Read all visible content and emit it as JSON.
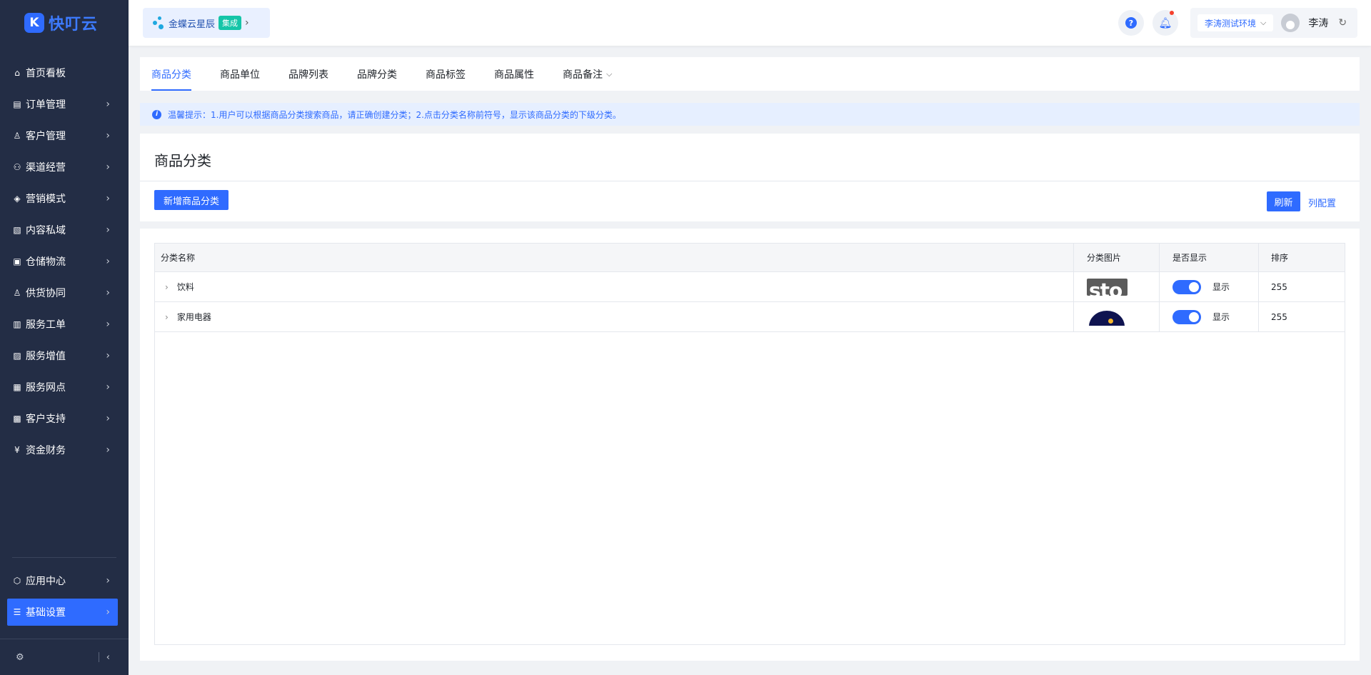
{
  "app": {
    "logo_text": "快叮云",
    "logo_mark": "K"
  },
  "sidebar": {
    "items": [
      {
        "label": "首页看板",
        "icon": "home-icon",
        "glyph": "⌂",
        "arrow": false
      },
      {
        "label": "订单管理",
        "icon": "clipboard-icon",
        "glyph": "▤",
        "arrow": true
      },
      {
        "label": "客户管理",
        "icon": "user-icon",
        "glyph": "♙",
        "arrow": true
      },
      {
        "label": "渠道经营",
        "icon": "channel-icon",
        "glyph": "⚇",
        "arrow": true
      },
      {
        "label": "营销模式",
        "icon": "tag-icon",
        "glyph": "◈",
        "arrow": true
      },
      {
        "label": "内容私域",
        "icon": "image-icon",
        "glyph": "▧",
        "arrow": true
      },
      {
        "label": "仓储物流",
        "icon": "warehouse-icon",
        "glyph": "▣",
        "arrow": true
      },
      {
        "label": "供货协同",
        "icon": "supplier-icon",
        "glyph": "♙",
        "arrow": true
      },
      {
        "label": "服务工单",
        "icon": "ticket-icon",
        "glyph": "▥",
        "arrow": true
      },
      {
        "label": "服务增值",
        "icon": "bag-icon",
        "glyph": "▨",
        "arrow": true
      },
      {
        "label": "服务网点",
        "icon": "store-icon",
        "glyph": "▦",
        "arrow": true
      },
      {
        "label": "客户支持",
        "icon": "support-icon",
        "glyph": "▩",
        "arrow": true
      },
      {
        "label": "资金财务",
        "icon": "yuan-icon",
        "glyph": "¥",
        "arrow": true
      }
    ],
    "bottom_items": [
      {
        "label": "应用中心",
        "icon": "cube-icon",
        "glyph": "⬡"
      },
      {
        "label": "基础设置",
        "icon": "settings-list-icon",
        "glyph": "☰"
      }
    ]
  },
  "header": {
    "org_name": "金蝶云星辰",
    "org_tag": "集成",
    "help_glyph": "?",
    "env_label": "李涛测试环境",
    "user_name": "李涛"
  },
  "tabs": [
    {
      "label": "商品分类",
      "active": true
    },
    {
      "label": "商品单位",
      "active": false
    },
    {
      "label": "品牌列表",
      "active": false
    },
    {
      "label": "品牌分类",
      "active": false
    },
    {
      "label": "商品标签",
      "active": false
    },
    {
      "label": "商品属性",
      "active": false
    },
    {
      "label": "商品备注",
      "active": false,
      "dropdown": true
    }
  ],
  "tip": {
    "text": "温馨提示：1.用户可以根据商品分类搜索商品，请正确创建分类；2.点击分类名称前符号，显示该商品分类的下级分类。"
  },
  "page": {
    "title": "商品分类",
    "add_button": "新增商品分类",
    "refresh_button": "刷新",
    "column_config_link": "列配置"
  },
  "table": {
    "headers": {
      "name": "分类名称",
      "image": "分类图片",
      "show": "是否显示",
      "sort": "排序"
    },
    "rows": [
      {
        "name": "饮料",
        "image_text": "sto",
        "show_label": "显示",
        "sort": "255"
      },
      {
        "name": "家用电器",
        "image_text": "",
        "show_label": "显示",
        "sort": "255"
      }
    ]
  },
  "colors": {
    "primary": "#2f6bff",
    "sidebar_bg": "#232d45",
    "tag_teal": "#15c5a8",
    "notif_red": "#f5412d"
  }
}
